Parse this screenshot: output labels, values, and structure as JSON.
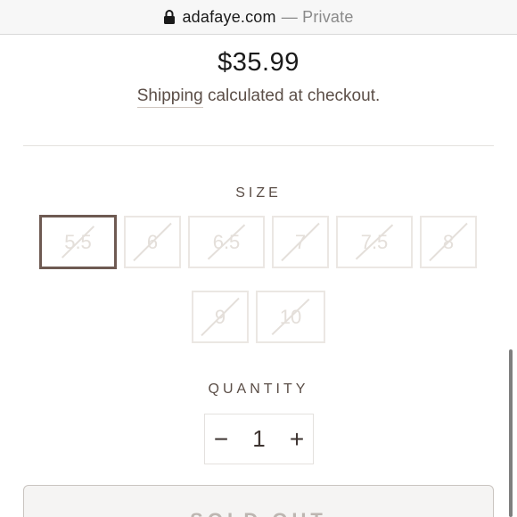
{
  "browser": {
    "domain": "adafaye.com",
    "private_label": "— Private"
  },
  "product": {
    "price": "$35.99",
    "shipping_link": "Shipping",
    "shipping_rest": " calculated at checkout."
  },
  "size": {
    "label": "SIZE",
    "options": [
      "5.5",
      "6",
      "6.5",
      "7",
      "7.5",
      "8",
      "9",
      "10"
    ],
    "selected": "5.5",
    "all_sold_out": true
  },
  "quantity": {
    "label": "QUANTITY",
    "minus": "−",
    "value": "1",
    "plus": "+"
  },
  "add_button": {
    "label": "SOLD OUT"
  },
  "colors": {
    "accent": "#6e5a52",
    "text": "#5b4e47",
    "disabled": "#e4dfda"
  }
}
